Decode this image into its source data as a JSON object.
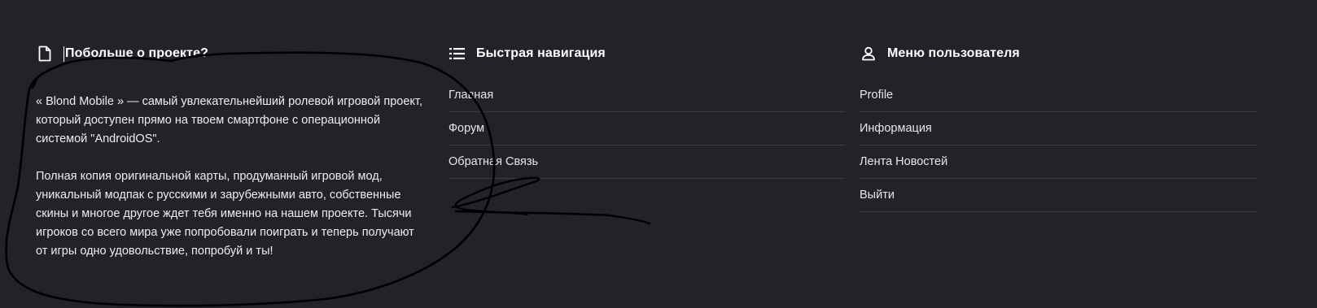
{
  "about": {
    "title": "Побольше о проекте?",
    "icon": "document-icon",
    "paragraph1": "« Blond Mobile » — самый увлекательнейший ролевой игровой проект, который доступен прямо на твоем смартфоне с операционной системой \"AndroidOS\".",
    "paragraph2": "Полная копия оригинальной карты, продуманный игровой мод, уникальный модпак с русскими и зарубежными авто, собственные скины и многое другое ждет тебя именно на нашем проекте. Тысячи игроков со всего мира уже попробовали поиграть и теперь получают от игры одно удовольствие, попробуй и ты!"
  },
  "nav": {
    "title": "Быстрая навигация",
    "icon": "list-icon",
    "items": [
      {
        "label": "Главная"
      },
      {
        "label": "Форум"
      },
      {
        "label": "Обратная Связь"
      }
    ]
  },
  "user_menu": {
    "title": "Меню пользователя",
    "icon": "user-icon",
    "items": [
      {
        "label": "Profile"
      },
      {
        "label": "Информация"
      },
      {
        "label": "Лента Новостей"
      },
      {
        "label": "Выйти"
      }
    ]
  },
  "colors": {
    "background": "#212328",
    "text": "#e9eaec",
    "divider": "#3b3e44",
    "scribble": "#000000"
  }
}
